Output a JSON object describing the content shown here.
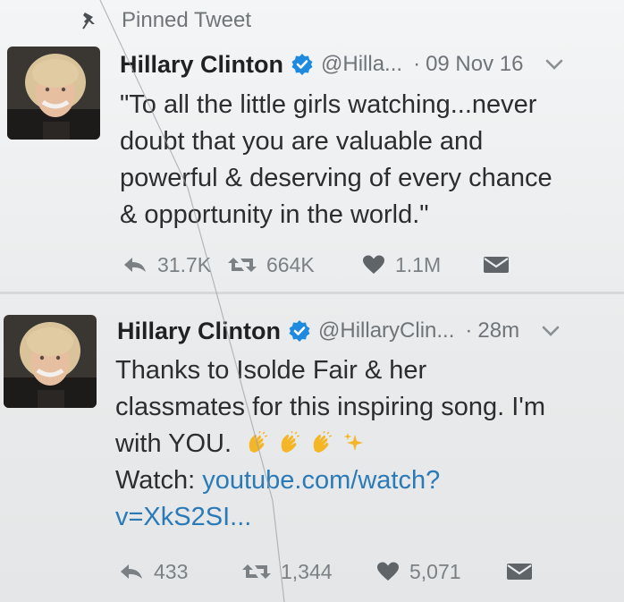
{
  "pinned": {
    "label": "Pinned Tweet",
    "icon": "pin-icon"
  },
  "tweets": [
    {
      "name": "Hillary Clinton",
      "handle": "@Hilla...",
      "separator": "·",
      "time": "09 Nov 16",
      "text_lines": [
        "\"To all the little girls watching...never",
        "doubt that you are valuable and",
        "powerful & deserving of every chance",
        "& opportunity in the world.\""
      ],
      "replies": "31.7K",
      "retweets": "664K",
      "likes": "1.1M"
    },
    {
      "name": "Hillary Clinton",
      "handle": "@HillaryClin...",
      "separator": "·",
      "time": "28m",
      "text_lines": [
        "Thanks to Isolde Fair & her",
        "classmates for this inspiring song. I'm"
      ],
      "text_line3": "with YOU.",
      "emojis": [
        "clapping-hands-emoji",
        "clapping-hands-emoji",
        "clapping-hands-emoji",
        "sparkles-emoji"
      ],
      "watch_label": "Watch: ",
      "link_part1": "youtube.com/watch?",
      "link_part2": "v=XkS2SI...",
      "replies": "433",
      "retweets": "1,344",
      "likes": "5,071"
    }
  ],
  "colors": {
    "verified": "#1f8be0",
    "link": "#2a7ab8",
    "muted": "#7b8085",
    "emoji_yellow": "#f4b626"
  }
}
